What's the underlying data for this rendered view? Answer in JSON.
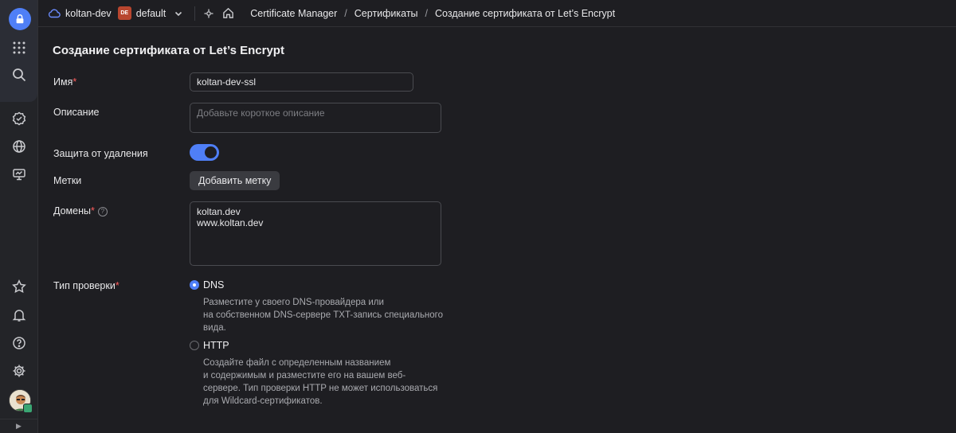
{
  "topbar": {
    "cloud_name": "koltan-dev",
    "folder_badge": "DE",
    "folder_name": "default",
    "breadcrumbs": [
      "Certificate Manager",
      "Сертификаты",
      "Создание сертификата от Let’s Encrypt"
    ]
  },
  "form": {
    "title": "Создание сертификата от Let’s Encrypt",
    "name_label": "Имя",
    "name_value": "koltan-dev-ssl",
    "description_label": "Описание",
    "description_placeholder": "Добавьте короткое описание",
    "deletion_protection_label": "Защита от удаления",
    "deletion_protection_on": true,
    "labels_label": "Метки",
    "add_label_button": "Добавить метку",
    "domains_label": "Домены",
    "domains_help": "?",
    "domains_value": "koltan.dev\nwww.koltan.dev",
    "check_type_label": "Тип проверки",
    "required_mark": "*",
    "check_options": [
      {
        "label": "DNS",
        "selected": true,
        "description": "Разместите у своего DNS-провайдера или\nна собственном DNS-сервере TXT-запись специального\nвида."
      },
      {
        "label": "HTTP",
        "selected": false,
        "description": "Создайте файл с определенным названием\nи содержимым и разместите его на вашем веб-\nсервере. Тип проверки HTTP не может использоваться\nдля Wildcard-сертификатов."
      }
    ]
  },
  "colors": {
    "accent": "#4f7ff7",
    "background": "#1e1e22",
    "required": "#ff5c5c"
  }
}
